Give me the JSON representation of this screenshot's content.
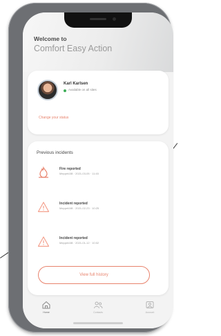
{
  "colors": {
    "accent": "#e8836d",
    "accent_light": "#f4a08d",
    "status_green": "#3fae5a",
    "nav_icon": "#b5b5b5"
  },
  "header": {
    "welcome": "Welcome to",
    "app_name": "Comfort Easy Action"
  },
  "profile": {
    "name": "Karl Karlsen",
    "status": "Available on all sites",
    "change_link": "Change your status"
  },
  "incidents": {
    "title": "Previous incidents",
    "items": [
      {
        "title": "Fire reported",
        "meta": "Meppel/AB · 2021-03-05 · 11:45",
        "icon": "fire-icon"
      },
      {
        "title": "Incident reported",
        "meta": "Meppel/AB · 2021-02-23 · 10:25",
        "icon": "warning-icon"
      },
      {
        "title": "Incident reported",
        "meta": "Meppel/AB · 2021-01-12 · 10:02",
        "icon": "warning-icon"
      }
    ],
    "history_button": "View full history"
  },
  "nav": {
    "items": [
      {
        "label": "Home",
        "icon": "home-icon",
        "active": true
      },
      {
        "label": "Contacts",
        "icon": "contacts-icon",
        "active": false
      },
      {
        "label": "Account",
        "icon": "account-icon",
        "active": false
      }
    ]
  }
}
